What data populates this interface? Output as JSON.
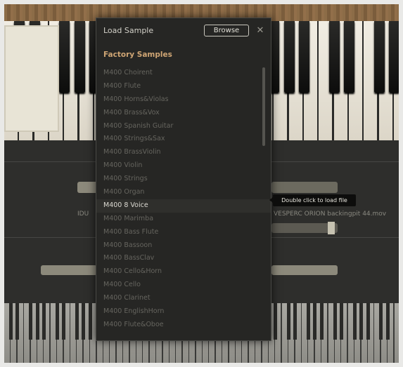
{
  "background": {
    "left_label": "IDU",
    "right_label": "VESPERC ORION backingpit 44.mov"
  },
  "dialog": {
    "title": "Load Sample",
    "browse_label": "Browse",
    "close_icon": "close-icon",
    "section_heading": "Factory Samples",
    "items": [
      "M400 Choirent",
      "M400 Flute",
      "M400 Horns&Violas",
      "M400 Brass&Vox",
      "M400 Spanish Guitar",
      "M400 Strings&Sax",
      "M400 BrassViolin",
      "M400 Violin",
      "M400 Strings",
      "M400 Organ",
      "M400 8 Voice",
      "M400 Marimba",
      "M400 Bass Flute",
      "M400 Bassoon",
      "M400 BassClav",
      "M400 Cello&Horn",
      "M400 Cello",
      "M400 Clarinet",
      "M400 EnglishHorn",
      "M400 Flute&Oboe"
    ],
    "selected_index": 10
  },
  "tooltip": {
    "text": "Double click to load file"
  }
}
